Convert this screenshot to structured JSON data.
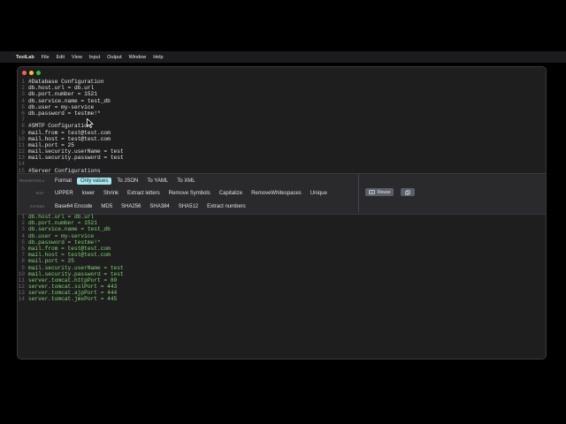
{
  "menubar": {
    "app_name": "TextLab",
    "items": [
      "File",
      "Edit",
      "View",
      "Input",
      "Output",
      "Window",
      "Help"
    ]
  },
  "window": {
    "dots": [
      "#ff5f57",
      "#febc2e",
      "#28c840"
    ]
  },
  "editor": {
    "lines": [
      {
        "n": "1",
        "t": "#Database Configuration"
      },
      {
        "n": "2",
        "t": "db.host.url = db.url"
      },
      {
        "n": "3",
        "t": "db.port.number = 1521"
      },
      {
        "n": "4",
        "t": "db.service.name = test_db"
      },
      {
        "n": "5",
        "t": "db.user = my-service"
      },
      {
        "n": "6",
        "t": "db.password = testme!*"
      },
      {
        "n": "7",
        "t": ""
      },
      {
        "n": "8",
        "t": "#SMTP Configuration"
      },
      {
        "n": "9",
        "t": "mail.from = test@test.com"
      },
      {
        "n": "10",
        "t": "mail.host = test@test.com"
      },
      {
        "n": "11",
        "t": "mail.port = 25"
      },
      {
        "n": "12",
        "t": "mail.security.userName = test"
      },
      {
        "n": "13",
        "t": "mail.security.password = test"
      },
      {
        "n": "14",
        "t": ""
      },
      {
        "n": "15",
        "t": "#Server Configurations"
      }
    ]
  },
  "toolbar": {
    "properties_label": "PROPERTIES ▾",
    "text_label": "TEXT",
    "extras_label": "EXTRAS",
    "properties_buttons": [
      "Format",
      "Only values",
      "To JSON",
      "To YAML",
      "To XML"
    ],
    "active_button": "Only values",
    "text_buttons": [
      "UPPER",
      "lower",
      "Shrink",
      "Extract letters",
      "Remove Symbols",
      "Capitalize",
      "RemoveWhitespaces",
      "Unique"
    ],
    "extras_buttons": [
      "Base64 Encode",
      "MD5",
      "SHA256",
      "SHA384",
      "SHA512",
      "Extract numbers"
    ],
    "reuse_label": "Reuse",
    "active_color": "#a6e6ea"
  },
  "output": {
    "color": "#7ad86a",
    "lines": [
      {
        "n": "1",
        "t": "db.host.url = db.url"
      },
      {
        "n": "2",
        "t": "db.port.number = 1521"
      },
      {
        "n": "3",
        "t": "db.service.name = test_db"
      },
      {
        "n": "4",
        "t": "db.user = my-service"
      },
      {
        "n": "5",
        "t": "db.password = testme!*"
      },
      {
        "n": "6",
        "t": "mail.from = test@test.com"
      },
      {
        "n": "7",
        "t": "mail.host = test@test.com"
      },
      {
        "n": "8",
        "t": "mail.port = 25"
      },
      {
        "n": "9",
        "t": "mail.security.userName = test"
      },
      {
        "n": "10",
        "t": "mail.security.password = test"
      },
      {
        "n": "11",
        "t": "server.tomcat.httpPort = 80"
      },
      {
        "n": "12",
        "t": "server.tomcat.sslPort = 443"
      },
      {
        "n": "13",
        "t": "server.tomcat.ajpPort = 444"
      },
      {
        "n": "14",
        "t": "server.tomcat.jmxPort = 445"
      }
    ]
  }
}
